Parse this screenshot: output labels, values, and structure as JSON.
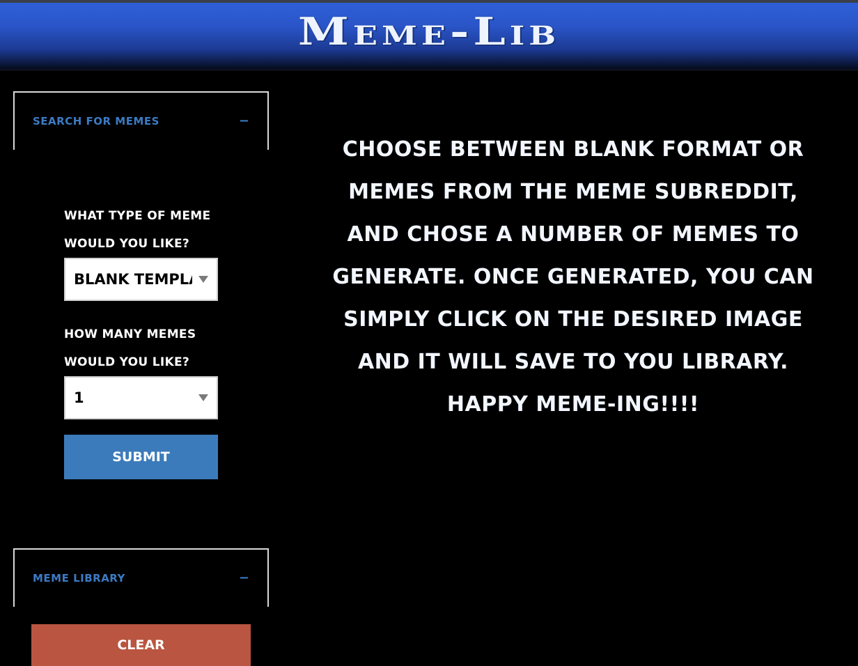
{
  "header": {
    "title": "Meme-Lib"
  },
  "search_panel": {
    "title": "Search for memes",
    "toggle": "−",
    "type_label": "What type of meme would you like?",
    "type_select": {
      "selected": "Blank Template"
    },
    "count_label": "How many memes would you like?",
    "count_select": {
      "selected": "1"
    },
    "submit_label": "Submit"
  },
  "library_panel": {
    "title": "Meme Library",
    "toggle": "−",
    "clear_label": "Clear"
  },
  "main": {
    "instructions": "Choose between blank format or memes from the meme subreddit, and chose a number of memes to generate. Once generated, you can simply click on the desired image and it will save to you library. Happy meme-ing!!!!"
  },
  "colors": {
    "accent_blue": "#3c7bbb",
    "clear_red": "#b95540",
    "header_blue": "#2f5fd8"
  }
}
